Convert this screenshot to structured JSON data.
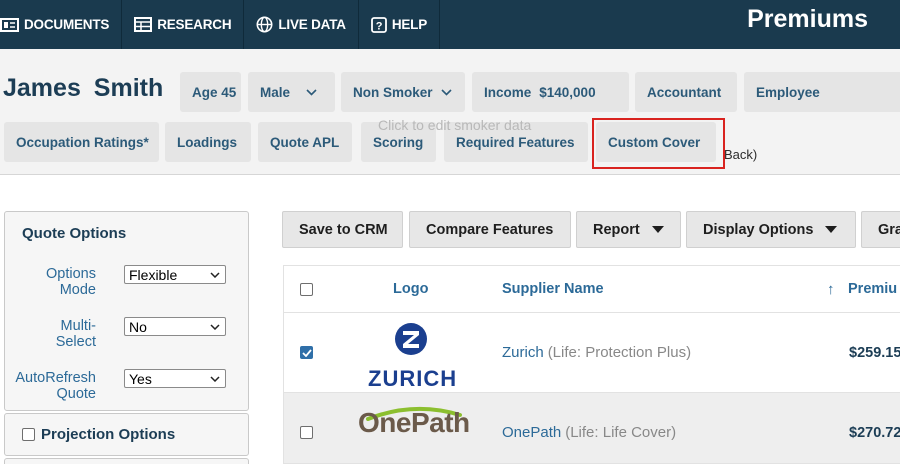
{
  "nav": {
    "items": [
      {
        "label": "DOCUMENTS",
        "icon": "documents-icon"
      },
      {
        "label": "RESEARCH",
        "icon": "research-icon"
      },
      {
        "label": "LIVE DATA",
        "icon": "globe-icon"
      },
      {
        "label": "HELP",
        "icon": "help-icon"
      }
    ],
    "brand": "Premiums"
  },
  "client": {
    "name": "James  Smith",
    "age": "Age 45",
    "gender": "Male",
    "smoker": "Non Smoker",
    "income_label": "Income",
    "income_value": "$140,000",
    "occupation": "Accountant",
    "employment": "Employee",
    "smoker_tooltip": "Click to edit smoker data"
  },
  "tabs": {
    "occupation_ratings": "Occupation Ratings*",
    "loadings": "Loadings",
    "quote_apl": "Quote APL",
    "scoring": "Scoring",
    "required_features": "Required Features",
    "custom_cover": "Custom Cover",
    "back_text": "Back)"
  },
  "quote_options": {
    "title": "Quote Options",
    "options_mode_label": "Options Mode",
    "options_mode_value": "Flexible",
    "multi_select_label": "Multi-Select",
    "multi_select_value": "No",
    "autorefresh_label": "AutoRefresh Quote",
    "autorefresh_value": "Yes"
  },
  "projection_options": {
    "label": "Projection Options"
  },
  "toolbar": {
    "save_to_crm": "Save to CRM",
    "compare_features": "Compare Features",
    "report": "Report",
    "display_options": "Display Options",
    "graph": "Gra"
  },
  "table": {
    "headers": {
      "logo": "Logo",
      "supplier_name": "Supplier Name",
      "sort_arrow": "↑",
      "premium": "Premiu"
    },
    "rows": [
      {
        "logo_text": "ZURICH",
        "supplier": "Zurich",
        "product": "(Life: Protection Plus)",
        "premium": "$259.15",
        "checked": true
      },
      {
        "logo_text": "OnePath",
        "supplier": "OnePath",
        "product": "(Life: Life Cover)",
        "premium": "$270.72",
        "checked": false
      }
    ]
  },
  "colors": {
    "nav_bg": "#1a3a4e",
    "accent_blue": "#2c6a98",
    "highlight_red": "#d9231f",
    "zurich_blue": "#1b3f8f",
    "onepath_green": "#8cbf2f"
  }
}
